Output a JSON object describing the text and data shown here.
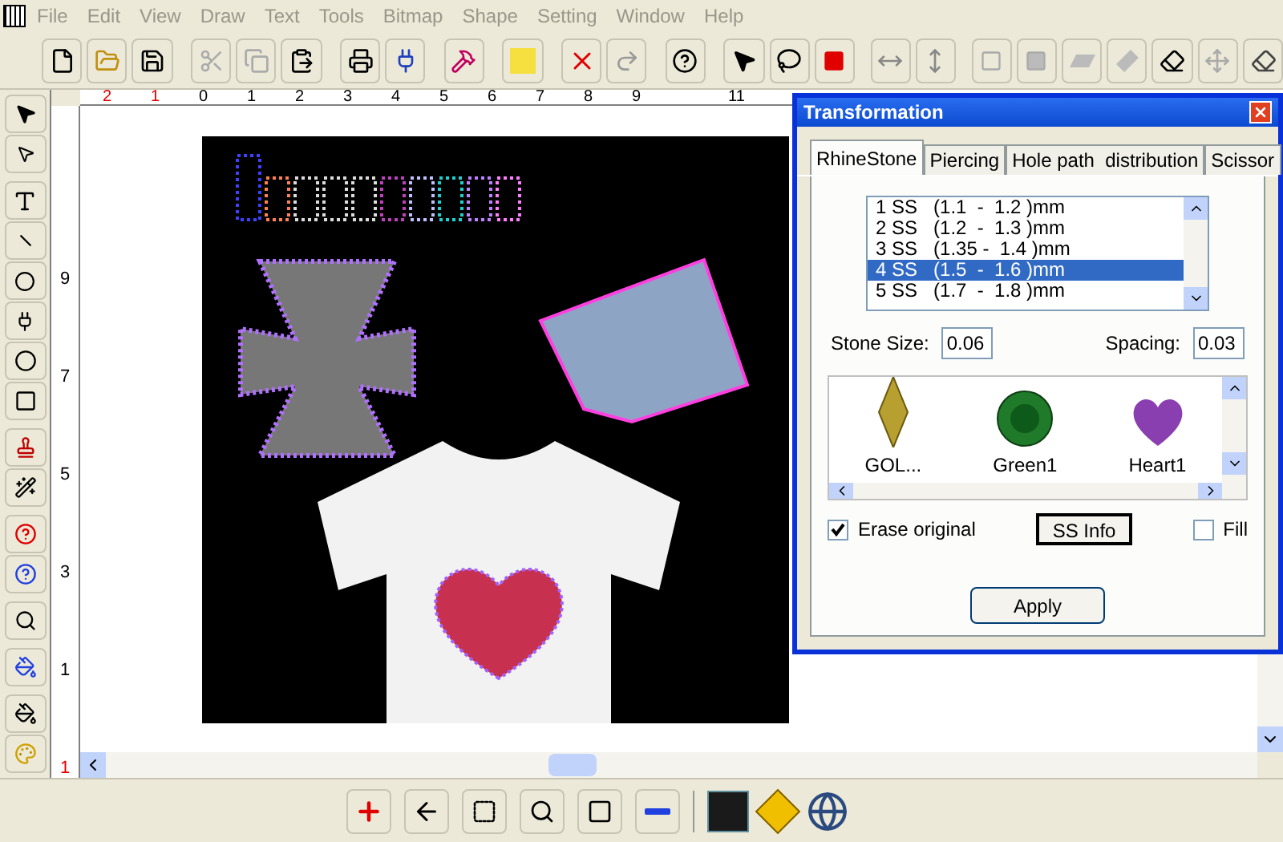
{
  "menu": [
    "File",
    "Edit",
    "View",
    "Draw",
    "Text",
    "Tools",
    "Bitmap",
    "Shape",
    "Setting",
    "Window",
    "Help"
  ],
  "ruler_top": [
    {
      "label": "2",
      "kind": "negative"
    },
    {
      "label": "1",
      "kind": "negative"
    },
    {
      "label": "0",
      "kind": "positive"
    },
    {
      "label": "1",
      "kind": "positive"
    },
    {
      "label": "2",
      "kind": "positive"
    },
    {
      "label": "3",
      "kind": "positive"
    },
    {
      "label": "4",
      "kind": "positive"
    },
    {
      "label": "5",
      "kind": "positive"
    },
    {
      "label": "6",
      "kind": "positive"
    },
    {
      "label": "7",
      "kind": "positive"
    },
    {
      "label": "8",
      "kind": "positive"
    },
    {
      "label": "9",
      "kind": "positive"
    },
    {
      "label": "11",
      "kind": "positive"
    }
  ],
  "ruler_left": [
    {
      "label": "9",
      "kind": "positive"
    },
    {
      "label": "7",
      "kind": "positive"
    },
    {
      "label": "5",
      "kind": "positive"
    },
    {
      "label": "3",
      "kind": "positive"
    },
    {
      "label": "1",
      "kind": "positive"
    },
    {
      "label": "1",
      "kind": "negative"
    }
  ],
  "dialog": {
    "title": "Transformation",
    "tabs": [
      {
        "label": "RhineStone",
        "selected": true
      },
      {
        "label": "Piercing",
        "selected": false
      },
      {
        "label": "Hole path  distribution",
        "selected": false
      },
      {
        "label": "Scissor",
        "selected": false
      }
    ],
    "sizes": [
      {
        "label": "1 SS   (1.1  -  1.2 )mm",
        "selected": false
      },
      {
        "label": "2 SS   (1.2  -  1.3 )mm",
        "selected": false
      },
      {
        "label": "3 SS   (1.35 -  1.4 )mm",
        "selected": false
      },
      {
        "label": "4 SS   (1.5  -  1.6 )mm",
        "selected": true
      },
      {
        "label": "5 SS   (1.7  -  1.8 )mm",
        "selected": false
      }
    ],
    "stone_size": {
      "label": "Stone Size:",
      "value": "0.06"
    },
    "spacing": {
      "label": "Spacing:",
      "value": "0.03"
    },
    "stones": [
      {
        "name": "GOL...",
        "kind": "marquise"
      },
      {
        "name": "Green1",
        "kind": "round"
      },
      {
        "name": "Heart1",
        "kind": "heart"
      }
    ],
    "erase_original": {
      "label": "Erase original",
      "checked": true
    },
    "ss_info": "SS Info",
    "fill": {
      "label": "Fill",
      "checked": false
    },
    "apply": "Apply"
  }
}
